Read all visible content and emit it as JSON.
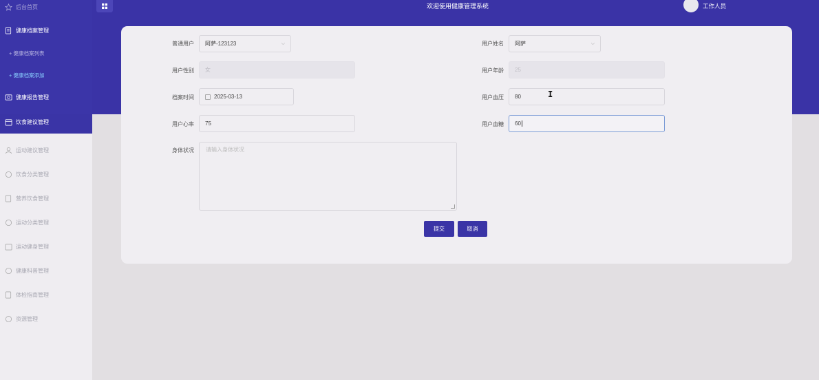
{
  "sidebar": {
    "items": [
      {
        "label": "后台首页",
        "icon": "star-icon"
      },
      {
        "label": "健康档案管理",
        "icon": "document-icon"
      },
      {
        "label": "+ 健康档案列表"
      },
      {
        "label": "+ 健康档案添加"
      },
      {
        "label": "健康报告管理",
        "icon": "report-icon"
      },
      {
        "label": "饮食建议管理",
        "icon": "calendar-icon"
      },
      {
        "label": "运动建议管理",
        "icon": "user-icon"
      },
      {
        "label": "饮食分类管理",
        "icon": "circle-icon"
      },
      {
        "label": "营养饮食管理",
        "icon": "document-icon"
      },
      {
        "label": "运动分类管理",
        "icon": "circle-icon"
      },
      {
        "label": "运动健身管理",
        "icon": "calendar-icon"
      },
      {
        "label": "健康科普管理",
        "icon": "circle-icon"
      },
      {
        "label": "体检指南管理",
        "icon": "document-icon"
      },
      {
        "label": "资源管理",
        "icon": "circle-icon"
      }
    ]
  },
  "header": {
    "welcome": "欢迎使用健康管理系统",
    "user": "工作人员"
  },
  "form": {
    "user_label": "普通用户",
    "user_value": "阿萨-123123",
    "name_label": "用户姓名",
    "name_value": "阿萨",
    "gender_label": "用户性别",
    "gender_value": "女",
    "age_label": "用户年龄",
    "age_value": "25",
    "date_label": "档案时间",
    "date_value": "2025-03-13",
    "bp_label": "用户血压",
    "bp_value": "80",
    "hr_label": "用户心率",
    "hr_value": "75",
    "bs_label": "用户血糖",
    "bs_value": "60",
    "condition_label": "身体状况",
    "condition_placeholder": "请输入身体状况",
    "submit": "提交",
    "cancel": "取消"
  }
}
